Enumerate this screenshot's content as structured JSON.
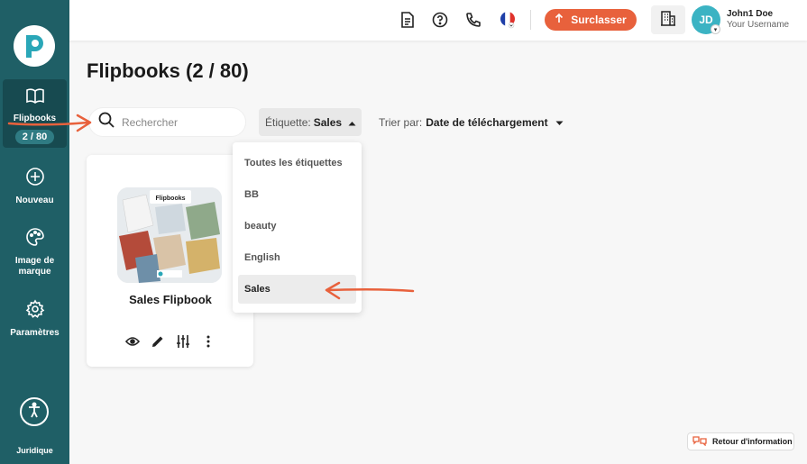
{
  "sidebar": {
    "items": [
      {
        "label": "Flipbooks",
        "badge": "2 / 80"
      },
      {
        "label": "Nouveau"
      },
      {
        "label": "Image de marque"
      },
      {
        "label": "Paramètres"
      }
    ],
    "footer": "Juridique"
  },
  "header": {
    "upgrade_label": "Surclasser",
    "avatar_initials": "JD",
    "user_name": "John1 Doe",
    "user_sub": "Your Username"
  },
  "page": {
    "title": "Flipbooks (2 / 80)"
  },
  "search": {
    "placeholder": "Rechercher"
  },
  "tag_filter": {
    "label": "Étiquette:",
    "value": "Sales"
  },
  "sort": {
    "label": "Trier par:",
    "value": "Date de téléchargement"
  },
  "dropdown": {
    "options": [
      "Toutes les étiquettes",
      "BB",
      "beauty",
      "English",
      "Sales"
    ],
    "selected": "Sales"
  },
  "card": {
    "title": "Sales Flipbook",
    "thumb_heading": "Flipbooks"
  },
  "feedback": {
    "label": "Retour d'information"
  },
  "colors": {
    "sidebar": "#1f5f66",
    "accent": "#e8613c",
    "avatar": "#3bb3c3"
  }
}
